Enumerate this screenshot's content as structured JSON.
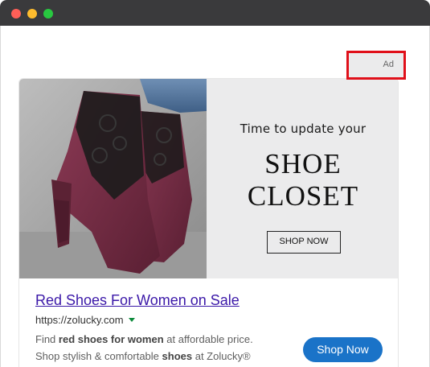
{
  "window": {
    "controls": {
      "close_color": "#ff5f57",
      "minimize_color": "#febc2e",
      "maximize_color": "#28c840"
    }
  },
  "ad": {
    "badge": "Ad",
    "banner": {
      "tagline": "Time to update your",
      "headline_line1": "SHOE",
      "headline_line2": "CLOSET",
      "button_label": "SHOP NOW",
      "image_icon": "lace-ankle-boots-photo"
    },
    "title": "Red Shoes For Women on Sale",
    "display_url": "https://zolucky.com",
    "description": {
      "line1_pre": "Find ",
      "line1_bold": "red shoes for women",
      "line1_post": " at affordable price.",
      "line2_pre": "Shop stylish & comfortable ",
      "line2_bold": "shoes",
      "line2_post": " at Zolucky®"
    },
    "cta_label": "Shop Now",
    "colors": {
      "title_link": "#3b18a8",
      "cta_background": "#1a73c8",
      "url_arrow": "#0b8a3a",
      "badge_highlight": "#e0101a"
    }
  }
}
